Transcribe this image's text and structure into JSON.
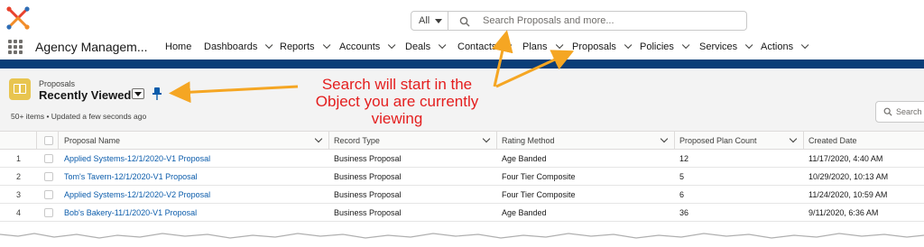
{
  "header": {
    "search_scope": "All",
    "search_placeholder": "Search Proposals and more..."
  },
  "nav": {
    "app_name": "Agency Managem...",
    "items": [
      {
        "label": "Home"
      },
      {
        "label": "Dashboards"
      },
      {
        "label": "Reports"
      },
      {
        "label": "Accounts"
      },
      {
        "label": "Deals"
      },
      {
        "label": "Contacts"
      },
      {
        "label": "Plans"
      },
      {
        "label": "Proposals"
      },
      {
        "label": "Policies"
      },
      {
        "label": "Services"
      },
      {
        "label": "Actions"
      }
    ],
    "active": "Proposals"
  },
  "list_view": {
    "object_label": "Proposals",
    "view_name": "Recently Viewed",
    "status": "50+ items • Updated a few seconds ago",
    "search_placeholder": "Search"
  },
  "table": {
    "columns": [
      "Proposal Name",
      "Record Type",
      "Rating Method",
      "Proposed Plan Count",
      "Created Date"
    ],
    "rows": [
      {
        "num": "1",
        "name": "Applied Systems-12/1/2020-V1 Proposal",
        "record_type": "Business Proposal",
        "rating": "Age Banded",
        "count": "12",
        "created": "11/17/2020, 4:40 AM"
      },
      {
        "num": "2",
        "name": "Tom's Tavern-12/1/2020-V1 Proposal",
        "record_type": "Business Proposal",
        "rating": "Four Tier Composite",
        "count": "5",
        "created": "10/29/2020, 10:13 AM"
      },
      {
        "num": "3",
        "name": "Applied Systems-12/1/2020-V2 Proposal",
        "record_type": "Business Proposal",
        "rating": "Four Tier Composite",
        "count": "6",
        "created": "11/24/2020, 10:59 AM"
      },
      {
        "num": "4",
        "name": "Bob's Bakery-11/1/2020-V1 Proposal",
        "record_type": "Business Proposal",
        "rating": "Age Banded",
        "count": "36",
        "created": "9/11/2020, 6:36 AM"
      }
    ]
  },
  "annotation": {
    "text_line1": "Search will start in the",
    "text_line2": "Object you are currently",
    "text_line3": "viewing",
    "color": "#e41e1e",
    "arrow_color": "#f5a623"
  },
  "colors": {
    "brand_band": "#0b3e78",
    "link": "#0b5cab",
    "object_icon": "#e8c550"
  }
}
